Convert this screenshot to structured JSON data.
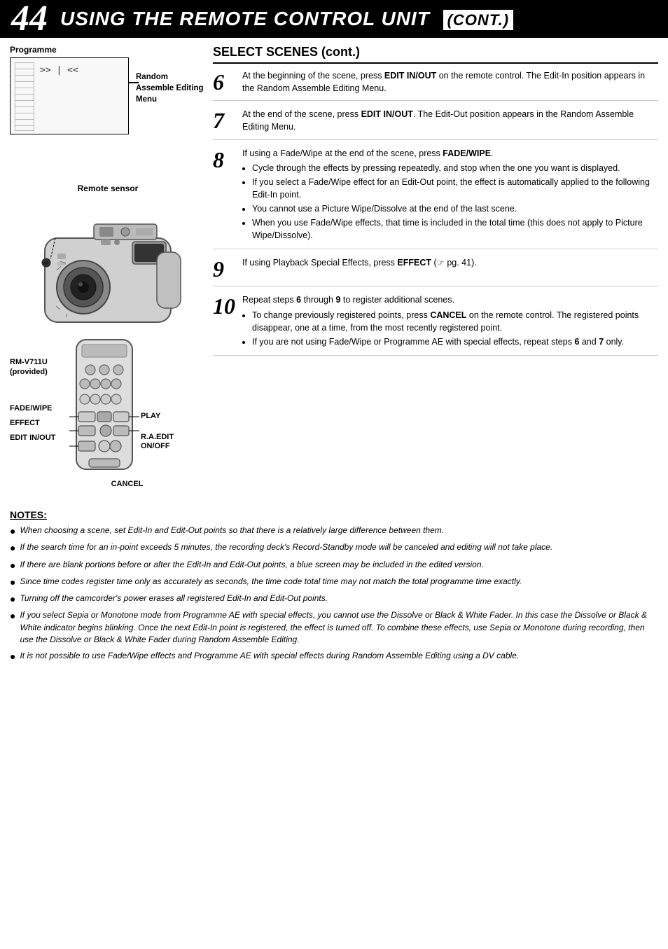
{
  "header": {
    "page_num": "44",
    "title": "USING THE REMOTE CONTROL UNIT",
    "cont": "(cont.)"
  },
  "left_col": {
    "programme_label": "Programme",
    "random_assemble_label": "Random Assemble\nEditing Menu",
    "remote_sensor_label": "Remote sensor",
    "remote_labels_left": [
      "RM-V711U\n(provided)",
      "FADE/WIPE",
      "EFFECT",
      "EDIT IN/OUT"
    ],
    "remote_labels_right": [
      "PLAY",
      "R.A.EDIT\nON/OFF"
    ],
    "cancel_label": "CANCEL"
  },
  "select_scenes": {
    "title": "SELECT SCENES (cont.)",
    "steps": [
      {
        "num": "6",
        "text": "At the beginning of the scene, press <b>EDIT IN/OUT</b> on the remote control. The Edit-In position appears in the Random Assemble Editing Menu."
      },
      {
        "num": "7",
        "text": "At the end of the scene, press <b>EDIT IN/OUT</b>. The Edit-Out position appears in the Random Assemble Editing Menu."
      },
      {
        "num": "8",
        "text": "If using a Fade/Wipe at the end of the scene, press <b>FADE/WIPE</b>.",
        "bullets": [
          "Cycle through the effects by pressing repeatedly, and stop when the one you want is displayed.",
          "If you select a Fade/Wipe effect for an Edit-Out point, the effect is automatically applied to the following Edit-In point.",
          "You cannot use a Picture Wipe/Dissolve at the end of the last scene.",
          "When you use Fade/Wipe effects, that time is included in the total time (this does not apply to Picture Wipe/Dissolve)."
        ]
      },
      {
        "num": "9",
        "text": "If using Playback Special Effects, press <b>EFFECT</b> (☞ pg. 41)."
      },
      {
        "num": "10",
        "text": "Repeat steps <b>6</b> through <b>9</b> to register additional scenes.",
        "bullets": [
          "To change previously registered points, press <b>CANCEL</b> on the remote control. The registered points disappear, one at a time, from the most recently registered point.",
          "If you are not using Fade/Wipe or Programme AE with special effects, repeat steps <b>6</b> and <b>7</b> only."
        ]
      }
    ]
  },
  "notes": {
    "title": "NOTES:",
    "items": [
      "When choosing a scene, set Edit-In and Edit-Out points so that there is a relatively large difference between them.",
      "If the search time for an in-point exceeds 5 minutes, the recording deck's Record-Standby mode will be canceled and editing will not take place.",
      "If there are blank portions before or after the Edit-In and Edit-Out points, a blue screen may be included in the edited version.",
      "Since time codes register time only as accurately as seconds, the time code total time may not match the total programme time exactly.",
      "Turning off the camcorder's power erases all registered Edit-In and Edit-Out points.",
      "If you select Sepia or Monotone mode from Programme AE with special effects, you cannot use the Dissolve or Black & White Fader. In this case the Dissolve or Black & White indicator begins blinking. Once the next Edit-In point is registered, the effect is turned off. To combine these effects, use Sepia or Monotone during recording, then use the Dissolve or Black & White Fader during Random Assemble Editing.",
      "It is not possible to use Fade/Wipe effects and Programme AE with special effects during Random Assemble Editing using a DV cable."
    ]
  }
}
